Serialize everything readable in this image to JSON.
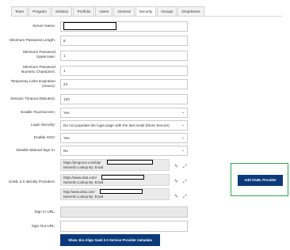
{
  "tabs": [
    {
      "label": "Team"
    },
    {
      "label": "Program"
    },
    {
      "label": "Solution"
    },
    {
      "label": "Portfolio"
    },
    {
      "label": "Users"
    },
    {
      "label": "General"
    },
    {
      "label": "Security",
      "active": true
    },
    {
      "label": "Groups"
    },
    {
      "label": "Dropdowns"
    }
  ],
  "form": {
    "server_name": {
      "label": "Server Name:",
      "value": ""
    },
    "min_password_length": {
      "label": "Minimum Password Length:",
      "value": "8"
    },
    "min_password_uppercase": {
      "label_1": "Minimum Password",
      "label_2": "Uppercase:",
      "value": "1"
    },
    "min_password_numeric": {
      "label_1": "Minimum Password",
      "label_2": "Numeric Characters:",
      "value": "1"
    },
    "temp_links_expiration": {
      "label_1": "Temporary Links Expiration",
      "label_2": "(Hours):",
      "value": "24"
    },
    "session_timeout": {
      "label": "Session Timeout (Minutes):",
      "value": "120"
    },
    "enable_touchscreen": {
      "label": "Enable Touchscreen:",
      "value": "Yes"
    },
    "login_security": {
      "label": "Login Security:",
      "value": "Do not populate the login page with the last email (More Secure)"
    },
    "enable_sso": {
      "label": "Enable SSO:",
      "value": "Yes"
    },
    "disable_manual_sign_in": {
      "label": "Disable Manual Sign In:",
      "value": "No"
    },
    "saml_identity_providers": {
      "label": "SAML 2.0 Identity Providers:",
      "items": [
        {
          "url": "https://jrmgrone.com/idp/",
          "nameid": "NameID Lookup By: Email"
        },
        {
          "url": "https://www.okta.com/",
          "nameid": "NameID Lookup By: Email"
        },
        {
          "url": "http://www.okta.com/",
          "nameid": "NameID Lookup By: Email"
        }
      ]
    },
    "sign_in_url": {
      "label": "Sign In URL:",
      "value": ""
    },
    "sign_out_url": {
      "label": "Sign Out URL:",
      "value": ""
    }
  },
  "buttons": {
    "add_saml_provider": "Add SAML Provider",
    "show_metadata": "Show Jira Align Saml 2.0 Service Provider metadata"
  },
  "icons": {
    "edit": "pencil-icon",
    "expand": "expand-icon",
    "dropdown": "chevron-down-icon"
  },
  "colors": {
    "primary_button": "#0b3a7b",
    "highlight_border": "#2fa84f",
    "disabled_field": "#e9e9e9"
  }
}
